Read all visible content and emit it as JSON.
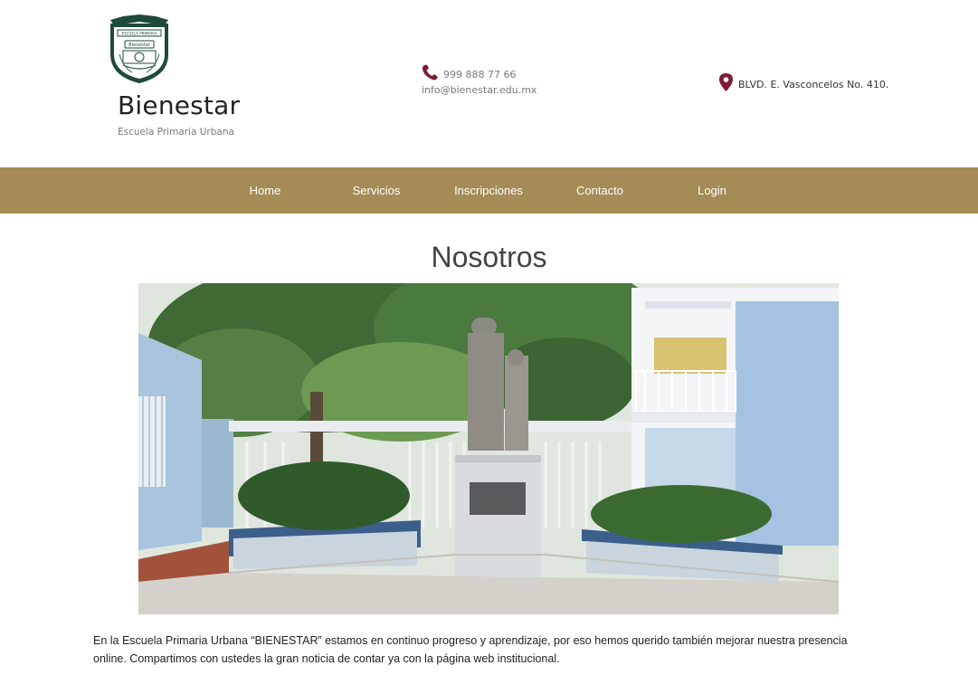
{
  "brand": {
    "name": "Bienestar",
    "subtitle": "Escuela Primaria Urbana",
    "logo_badge_text": "Bienestar",
    "logo_banner_text": "ESCUELA PRIMARIA"
  },
  "contact": {
    "phone": "999 888 77 66",
    "email": "info@bienestar.edu.mx",
    "address": "BLVD. E. Vasconcelos No. 410.",
    "icon_color": "#7a1d33"
  },
  "nav": {
    "background": "#a58b55",
    "items": [
      {
        "label": "Home"
      },
      {
        "label": "Servicios"
      },
      {
        "label": "Inscripciones"
      },
      {
        "label": "Contacto"
      },
      {
        "label": "Login"
      }
    ]
  },
  "main": {
    "title": "Nosotros",
    "hero_image": "school-courtyard-statue-photo",
    "paragraph": "En la Escuela Primaria Urbana “BIENESTAR” estamos en continuo progreso y aprendizaje, por eso hemos querido también mejorar nuestra presencia online. Compartimos con ustedes la gran noticia de contar ya con la página web institucional."
  }
}
